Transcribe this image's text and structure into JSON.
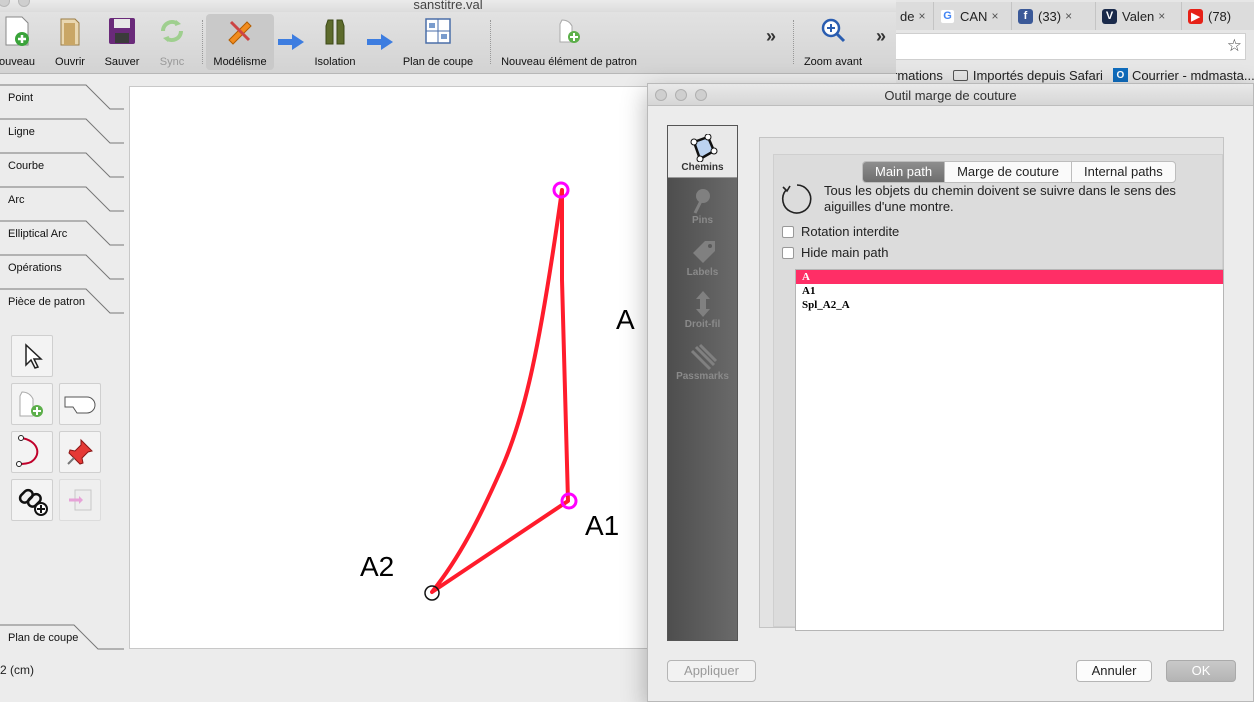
{
  "app": {
    "window_title": "sanstitre.val",
    "toolbar": {
      "new_label": "ouveau",
      "open_label": "Ouvrir",
      "save_label": "Sauver",
      "sync_label": "Sync",
      "modeling_label": "Modélisme",
      "isolation_label": "Isolation",
      "layout_label": "Plan de coupe",
      "new_piece_label": "Nouveau élément de patron",
      "zoom_in_label": "Zoom avant",
      "overflow_symbol": "»"
    },
    "tool_groups": [
      "Point",
      "Ligne",
      "Courbe",
      "Arc",
      "Elliptical Arc",
      "Opérations",
      "Pièce de patron"
    ],
    "layout_group": "Plan de coupe",
    "status_text": "2 (cm)",
    "drawing": {
      "labels": {
        "a": "A",
        "a1": "A1",
        "a2": "A2"
      },
      "curve_color": "#ff1c2c",
      "point_color": "#ff00ff"
    }
  },
  "browser": {
    "tabs": [
      {
        "title": "de",
        "icon": "generic"
      },
      {
        "title": "CAN",
        "icon": "google-icon"
      },
      {
        "title": "(33)",
        "icon": "facebook-icon"
      },
      {
        "title": "Valen",
        "icon": "site-icon"
      },
      {
        "title": "(78)",
        "icon": "youtube-icon"
      }
    ],
    "close_symbol": "×",
    "star_symbol": "☆",
    "bookmarks": [
      "rmations",
      "Importés depuis Safari",
      "Courrier - mdmasta..."
    ]
  },
  "dialog": {
    "title": "Outil marge de couture",
    "sidebar": [
      {
        "label": "Chemins",
        "icon": "paths-icon",
        "active": true
      },
      {
        "label": "Pins",
        "icon": "pin-icon",
        "active": false
      },
      {
        "label": "Labels",
        "icon": "label-icon",
        "active": false
      },
      {
        "label": "Droit-fil",
        "icon": "grainline-icon",
        "active": false
      },
      {
        "label": "Passmarks",
        "icon": "passmarks-icon",
        "active": false
      }
    ],
    "tabs": [
      "Main path",
      "Marge de couture",
      "Internal paths"
    ],
    "active_tab": "Main path",
    "info_text": "Tous les objets du chemin doivent se suivre dans le sens des aiguilles d'une montre.",
    "checkboxes": [
      {
        "label": "Rotation interdite",
        "checked": false
      },
      {
        "label": "Hide main path",
        "checked": false
      }
    ],
    "path_items": [
      "A",
      "A1",
      "Spl_A2_A"
    ],
    "selected_item": "A",
    "buttons": {
      "apply": "Appliquer",
      "cancel": "Annuler",
      "ok": "OK"
    },
    "accent_color": "#ff2e66"
  }
}
